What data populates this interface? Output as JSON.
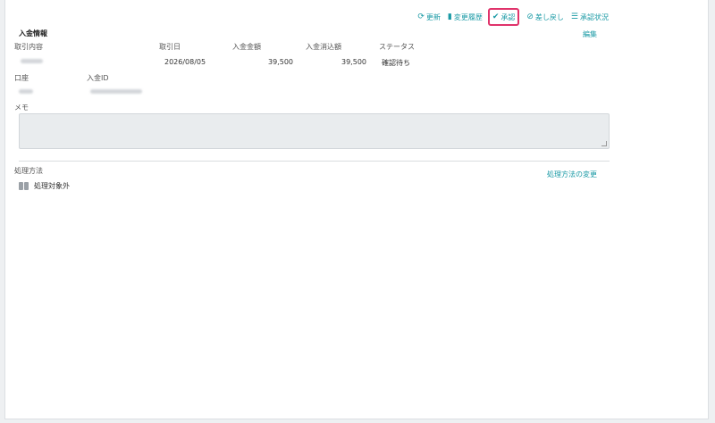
{
  "toolbar": {
    "refresh": {
      "label": "更新",
      "icon": "refresh-icon"
    },
    "history": {
      "label": "変更履歴",
      "icon": "document-icon"
    },
    "approve": {
      "label": "承認",
      "icon": "check-icon"
    },
    "reject": {
      "label": "差し戻し",
      "icon": "ban-icon"
    },
    "status": {
      "label": "承認状況",
      "icon": "list-icon"
    },
    "accent_color": "#1a9aa5",
    "highlight_color": "#e0336b"
  },
  "section": {
    "title": "入金情報",
    "edit_label": "編集"
  },
  "fields": {
    "transaction_label": "取引内容",
    "date_label": "取引日",
    "date_value": "2026/08/05",
    "amount_label": "入金金額",
    "amount_value": "39,500",
    "cleared_label": "入金消込額",
    "cleared_value": "39,500",
    "status_label": "ステータス",
    "status_value": "確認待ち",
    "account_label": "口座",
    "deposit_id_label": "入金ID",
    "memo_label": "メモ"
  },
  "processing": {
    "label": "処理方法",
    "change_label": "処理方法の変更",
    "value": "処理対象外",
    "icon": "book-icon"
  }
}
